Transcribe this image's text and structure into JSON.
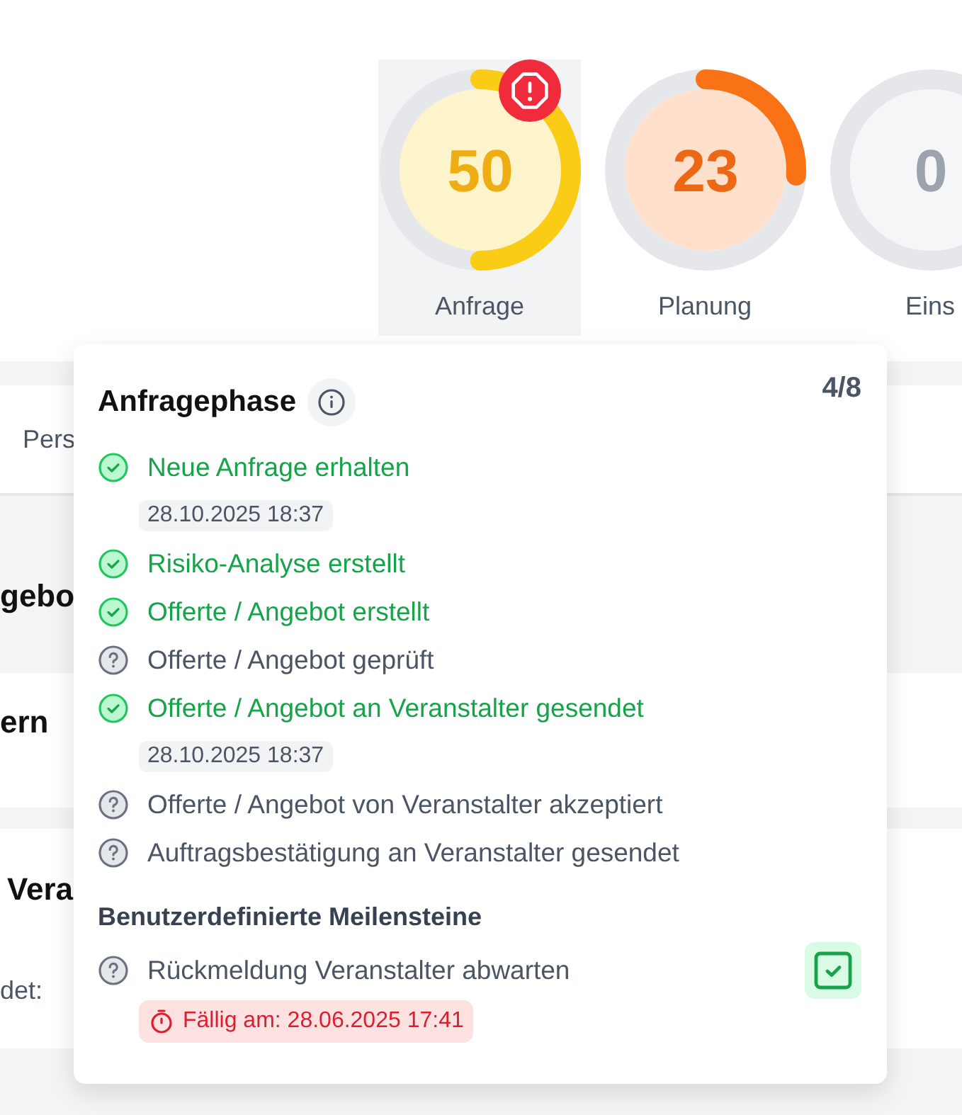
{
  "gauges": [
    {
      "value": "50",
      "label": "Anfrage",
      "level": 0.5,
      "color": "#facc15",
      "selected": true,
      "alert": true
    },
    {
      "value": "23",
      "label": "Planung",
      "level": 0.26,
      "color": "#f97316",
      "selected": false,
      "alert": false
    },
    {
      "value": "0",
      "label": "Eins",
      "selected": false,
      "alert": false
    }
  ],
  "background": {
    "tab_label": "Pers",
    "rows": [
      {
        "text": "gebo",
        "kind": "shaded"
      },
      {
        "text": "ern",
        "kind": "plain"
      }
    ],
    "card": {
      "title": "Vera",
      "detail": "det:"
    }
  },
  "popover": {
    "title": "Anfragephase",
    "progress": "4/8",
    "milestones": [
      {
        "label": "Neue Anfrage erhalten",
        "done": true,
        "date": "28.10.2025 18:37"
      },
      {
        "label": "Risiko-Analyse erstellt",
        "done": true
      },
      {
        "label": "Offerte / Angebot erstellt",
        "done": true
      },
      {
        "label": "Offerte / Angebot geprüft",
        "done": false
      },
      {
        "label": "Offerte / Angebot an Veranstalter gesendet",
        "done": true,
        "date": "28.10.2025 18:37"
      },
      {
        "label": "Offerte / Angebot von Veranstalter akzeptiert",
        "done": false
      },
      {
        "label": "Auftragsbestätigung an Veranstalter gesendet",
        "done": false
      }
    ],
    "custom_heading": "Benutzerdefinierte Meilensteine",
    "custom_milestones": [
      {
        "label": "Rückmeldung Veranstalter abwarten",
        "done": false,
        "checked": true,
        "due": "Fällig am: 28.06.2025 17:41"
      }
    ]
  }
}
